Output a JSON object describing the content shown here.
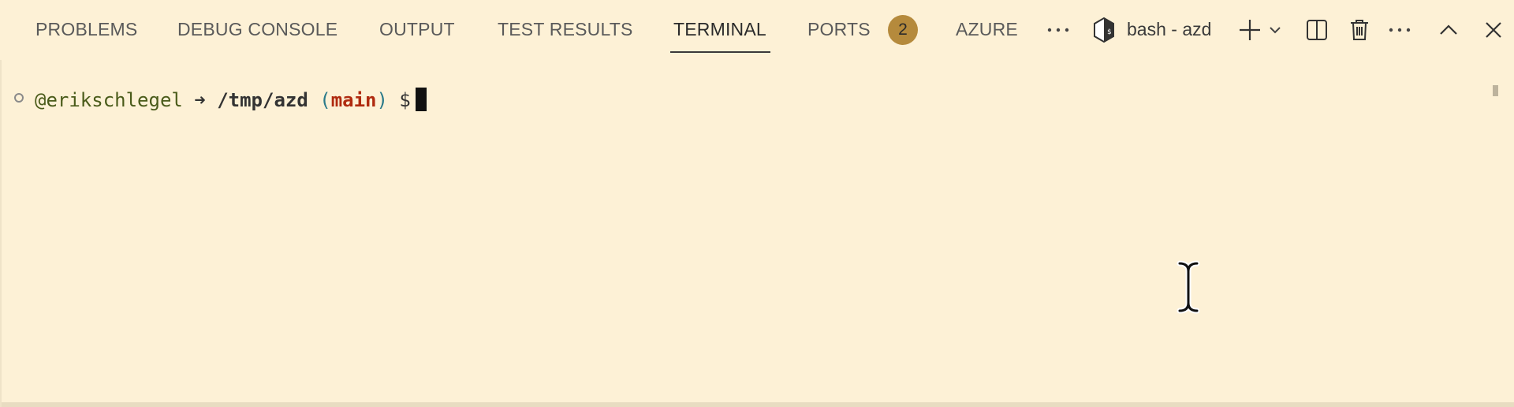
{
  "tabs": [
    {
      "label": "PROBLEMS"
    },
    {
      "label": "DEBUG CONSOLE"
    },
    {
      "label": "OUTPUT"
    },
    {
      "label": "TEST RESULTS"
    },
    {
      "label": "TERMINAL"
    },
    {
      "label": "PORTS"
    },
    {
      "label": "AZURE"
    }
  ],
  "active_tab": "TERMINAL",
  "ports_badge": "2",
  "more_tabs_icon": "ellipsis-icon",
  "terminal_selector": {
    "icon": "bash-shell-icon",
    "label": "bash - azd"
  },
  "toolbar_icons": [
    "plus-icon",
    "chevron-down-icon",
    "split-editor-icon",
    "trash-icon",
    "ellipsis-icon",
    "chevron-up-icon",
    "close-icon"
  ],
  "prompt": {
    "user": "@erikschlegel",
    "arrow": "➜",
    "path": "/tmp/azd",
    "open_paren": "(",
    "branch": "main",
    "close_paren": ")",
    "symbol": "$"
  },
  "colors": {
    "background": "#fdf1d6",
    "badge": "#b58a3c",
    "user": "#4a5b1a",
    "branch": "#b02b10",
    "paren": "#2a7a8a"
  }
}
